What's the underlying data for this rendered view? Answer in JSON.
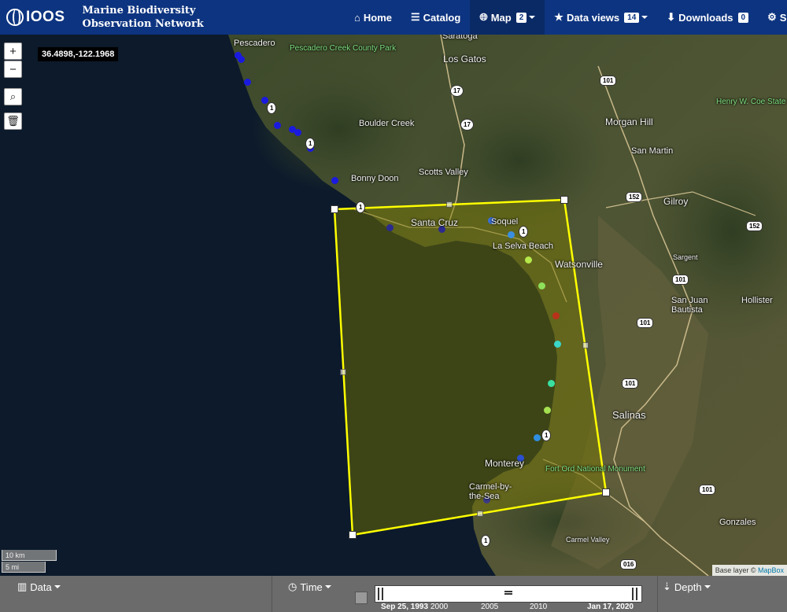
{
  "brand": {
    "logo": "IOOS",
    "title_line1": "Marine Biodiversity",
    "title_line2": "Observation Network"
  },
  "nav": {
    "home": "Home",
    "catalog": "Catalog",
    "map": "Map",
    "map_badge": "2",
    "data_views": "Data views",
    "data_views_badge": "14",
    "downloads": "Downloads",
    "downloads_badge": "0",
    "settings_partial": "S"
  },
  "map": {
    "coordinate_readout": "36.4898,-122.1968",
    "zoom_in": "+",
    "zoom_out": "−",
    "scale_km": "10 km",
    "scale_mi": "5 mi",
    "attribution_prefix": "Base layer ©",
    "attribution_link": "MapBox",
    "selection_color": "#ffff00",
    "places": {
      "pescadero": "Pescadero",
      "pescadero_park": "Pescadero Creek County Park",
      "saratoga": "Saratoga",
      "los_gatos": "Los Gatos",
      "boulder_creek": "Boulder Creek",
      "morgan_hill": "Morgan Hill",
      "henry_coe": "Henry W. Coe State Park",
      "san_martin": "San Martin",
      "scotts_valley": "Scotts Valley",
      "bonny_doon": "Bonny Doon",
      "gilroy": "Gilroy",
      "santa_cruz": "Santa Cruz",
      "soquel": "Soquel",
      "la_selva": "La Selva Beach",
      "watsonville": "Watsonville",
      "sargent": "Sargent",
      "san_juan_bautista": "San Juan Bautista",
      "hollister": "Hollister",
      "salinas": "Salinas",
      "monterey": "Monterey",
      "fort_ord": "Fort Ord National Monument",
      "carmel": "Carmel-by-the-Sea",
      "carmel_valley": "Carmel Valley",
      "gonzales": "Gonzales"
    },
    "shields": {
      "r101a": "101",
      "r17a": "17",
      "r17b": "17",
      "r152a": "152",
      "r152b": "152",
      "r1a": "1",
      "r1b": "1",
      "r1c": "1",
      "r1d": "1",
      "r1e": "1",
      "r1f": "1",
      "r101b": "101",
      "r101c": "101",
      "r101d": "101",
      "r101e": "101",
      "r016": "016"
    }
  },
  "bottom": {
    "data": "Data",
    "time": "Time",
    "depth": "Depth",
    "time_start": "Sep 25, 1993",
    "tick_2000": "2000",
    "tick_2005": "2005",
    "tick_2010": "2010",
    "time_end": "Jan 17, 2020"
  }
}
